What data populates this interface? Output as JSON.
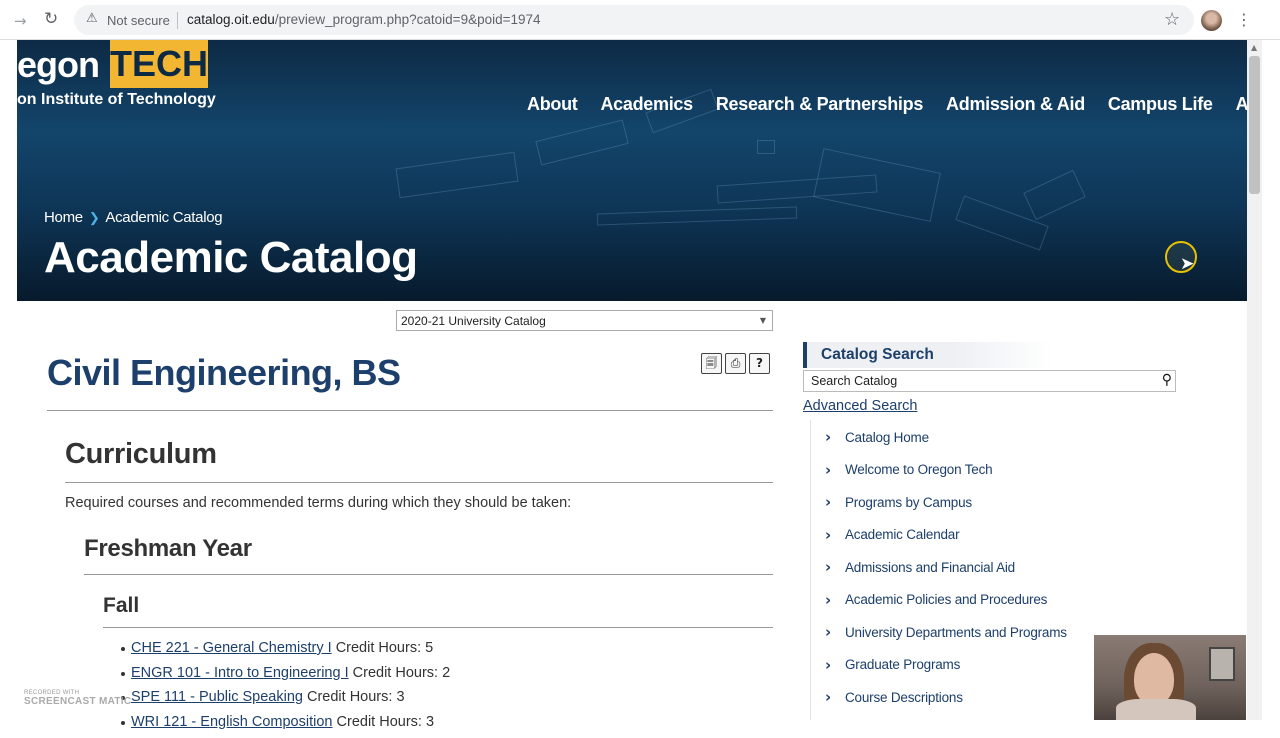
{
  "browser": {
    "security": "Not secure",
    "url_host": "catalog.oit.edu",
    "url_path": "/preview_program.php?catoid=9&poid=1974"
  },
  "header": {
    "logo_word": "egon",
    "logo_tech": "TECH",
    "logo_sub": "on Institute of Technology",
    "nav": [
      "About",
      "Academics",
      "Research & Partnerships",
      "Admission & Aid",
      "Campus Life",
      "Athletics"
    ],
    "breadcrumb": [
      "Home",
      "Academic Catalog"
    ],
    "title": "Academic Catalog"
  },
  "catalog_select": {
    "value": "2020-21 University Catalog"
  },
  "program": {
    "title": "Civil Engineering, BS",
    "section": "Curriculum",
    "intro": "Required courses and recommended terms during which they should be taken:",
    "year": "Freshman Year",
    "term": "Fall",
    "courses": [
      {
        "link": "CHE 221 - General Chemistry I",
        "credits": "Credit Hours: 5"
      },
      {
        "link": "ENGR 101 - Intro to Engineering I",
        "credits": "Credit Hours: 2"
      },
      {
        "link": "SPE 111 - Public Speaking",
        "credits": "Credit Hours: 3"
      },
      {
        "link": "WRI 121 - English Composition",
        "credits": "Credit Hours: 3"
      }
    ]
  },
  "sidebar": {
    "search_title": "Catalog Search",
    "search_value": "Search Catalog",
    "advanced": "Advanced Search",
    "items": [
      "Catalog Home",
      "Welcome to Oregon Tech",
      "Programs by Campus",
      "Academic Calendar",
      "Admissions and Financial Aid",
      "Academic Policies and Procedures",
      "University Departments and Programs",
      "Graduate Programs",
      "Course Descriptions"
    ]
  },
  "watermark": {
    "small": "RECORDED WITH",
    "big": "SCREENCAST MATIC"
  },
  "colors": {
    "brand_navy": "#1d3f6b",
    "brand_gold": "#f2b633",
    "accent_blue": "#4db3e6"
  }
}
